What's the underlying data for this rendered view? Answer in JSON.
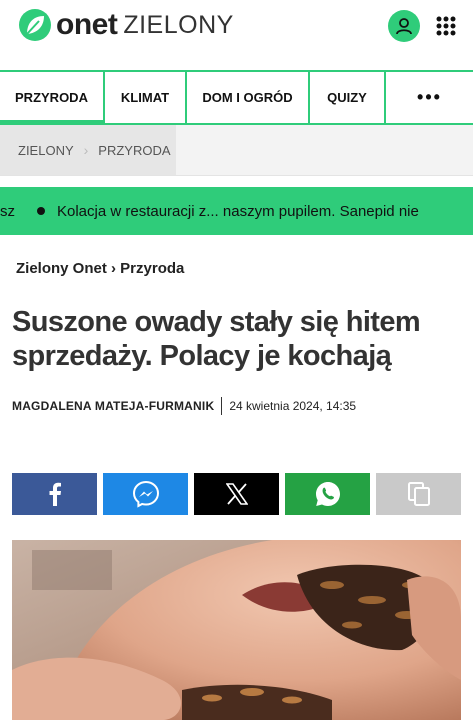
{
  "brand": {
    "name": "onet",
    "section": "ZIELONY"
  },
  "header": {
    "user_icon": "user-icon",
    "menu_icon": "grid-menu-icon"
  },
  "nav": {
    "tabs": [
      {
        "label": "PRZYRODA",
        "active": true
      },
      {
        "label": "KLIMAT",
        "active": false
      },
      {
        "label": "DOM I OGRÓD",
        "active": false
      },
      {
        "label": "QUIZY",
        "active": false
      },
      {
        "label": "•••",
        "active": false
      }
    ]
  },
  "breadcrumb": {
    "items": [
      "ZIELONY",
      "PRZYRODA"
    ]
  },
  "ticker": {
    "prev_fragment": "sz",
    "item": "Kolacja w restauracji z... naszym pupilem. Sanepid nie"
  },
  "article": {
    "section_path": "Zielony Onet › Przyroda",
    "title": "Suszone owady stały się hitem sprzedaży. Polacy je kochają",
    "author": "MAGDALENA MATEJA-FURMANIK",
    "date": "24 kwietnia 2024, 14:35"
  },
  "share": {
    "buttons": [
      {
        "name": "facebook",
        "icon": "facebook-icon",
        "color": "#3b5998"
      },
      {
        "name": "messenger",
        "icon": "messenger-icon",
        "color": "#1e88e5"
      },
      {
        "name": "x",
        "icon": "x-icon",
        "color": "#000000"
      },
      {
        "name": "whatsapp",
        "icon": "whatsapp-icon",
        "color": "#25a244"
      },
      {
        "name": "copy",
        "icon": "copy-icon",
        "color": "#c9c9c9"
      }
    ]
  },
  "colors": {
    "accent": "#2fcc7a",
    "headline": "#333333"
  }
}
